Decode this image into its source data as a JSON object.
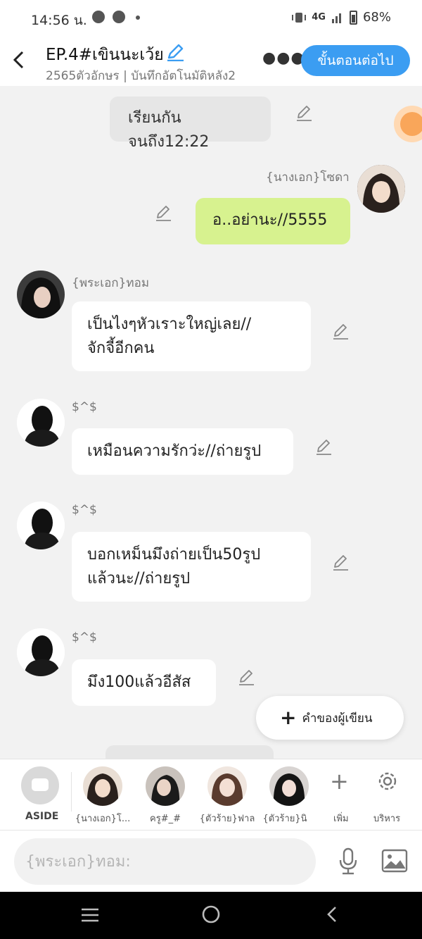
{
  "status_bar": {
    "time": "14:56 น.",
    "network": "4G",
    "battery": "68%"
  },
  "header": {
    "title": "EP.4#เขินนะเว้ย",
    "subtitle": "2565ตัวอักษร | บันทึกอัตโนมัติหลัง2",
    "next_button": "ขั้นตอนต่อไป"
  },
  "messages": {
    "m1_text": "เรียนกันจนถึง12:22",
    "m2_name": "{นางเอก}โซดา",
    "m2_text": "อ..อย่านะ//5555",
    "m3_name": "{พระเอก}ทอม",
    "m3_line1": "เป็นไงๆหัวเราะใหญ่เลย//",
    "m3_line2": "จักจี้อีกคน",
    "m4_name": "$^$",
    "m4_text": "เหมือนความรักว่ะ//ถ่ายรูป",
    "m5_name": "$^$",
    "m5_line1": "บอกเหม็นมึงถ่ายเป็น50รูป",
    "m5_line2": "แล้วนะ//ถ่ายรูป",
    "m6_name": "$^$",
    "m6_text": "มึง100แล้วอีสัส"
  },
  "author_note_button": "คำของผู้เขียน",
  "character_bar": {
    "aside_label": "ASIDE",
    "characters": [
      "{นางเอก}โ...",
      "ครู#_#",
      "{ตัวร้าย}ฟาล",
      "{ตัวร้าย}นิ"
    ],
    "add_label": "เพิ่ม",
    "manage_label": "บริหาร"
  },
  "input": {
    "placeholder": "{พระเอก}ทอม:"
  },
  "colors": {
    "accent": "#3b9df2",
    "self_bubble": "#d7f28f",
    "bubble": "#ffffff",
    "background": "#f2f2f2"
  }
}
